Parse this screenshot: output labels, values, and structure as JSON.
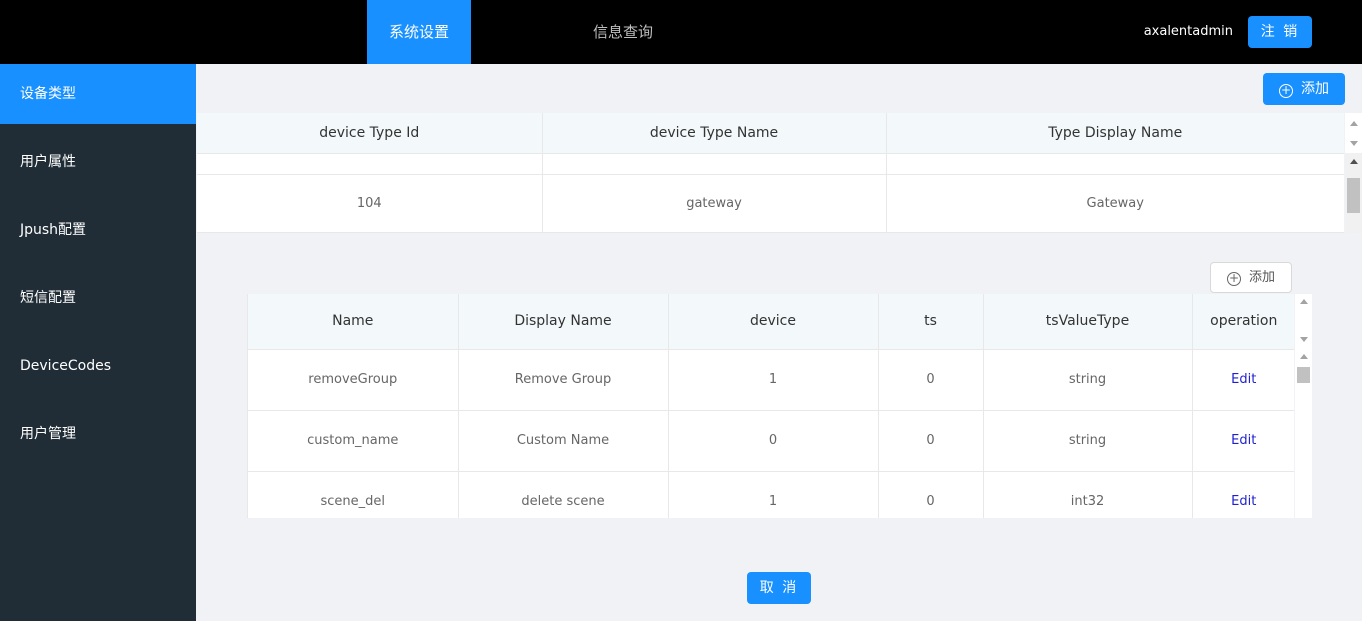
{
  "header": {
    "tabs": [
      {
        "label": "系统设置",
        "active": true
      },
      {
        "label": "信息查询",
        "active": false
      }
    ],
    "username": "axalentadmin",
    "logout_label": "注 销"
  },
  "sidebar": {
    "items": [
      {
        "label": "设备类型",
        "active": true
      },
      {
        "label": "用户属性"
      },
      {
        "label": "Jpush配置"
      },
      {
        "label": "短信配置"
      },
      {
        "label": "DeviceCodes"
      },
      {
        "label": "用户管理"
      }
    ]
  },
  "device_types": {
    "add_label": "添加",
    "columns": [
      "device Type Id",
      "device Type Name",
      "Type Display Name"
    ],
    "rows": [
      [
        "104",
        "gateway",
        "Gateway"
      ]
    ]
  },
  "attributes": {
    "add_label": "添加",
    "columns": [
      "Name",
      "Display Name",
      "device",
      "ts",
      "tsValueType",
      "operation"
    ],
    "rows": [
      [
        "removeGroup",
        "Remove Group",
        "1",
        "0",
        "string",
        "Edit"
      ],
      [
        "custom_name",
        "Custom Name",
        "0",
        "0",
        "string",
        "Edit"
      ],
      [
        "scene_del",
        "delete scene",
        "1",
        "0",
        "int32",
        "Edit"
      ]
    ]
  },
  "cancel_label": "取 消",
  "colors": {
    "accent": "#1890ff",
    "sidebar_bg": "#202d36",
    "topbar_bg": "#000000"
  }
}
